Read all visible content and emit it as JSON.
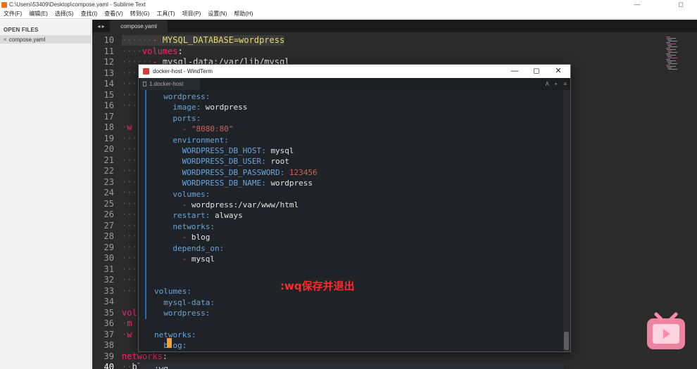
{
  "window": {
    "title": "C:\\Users\\53409\\Desktop\\compose.yaml - Sublime Text",
    "minimize": "—",
    "maximize": "◻",
    "close": "✕"
  },
  "menu": [
    "文件(F)",
    "编辑(E)",
    "选择(S)",
    "查找(I)",
    "查看(V)",
    "转到(G)",
    "工具(T)",
    "项目(P)",
    "设置(N)",
    "帮助(H)"
  ],
  "sidebar": {
    "heading": "OPEN FILES",
    "files": [
      {
        "close": "×",
        "name": "compose.yaml"
      }
    ]
  },
  "tabs": {
    "nav": "◂ ▸",
    "active": "compose.yaml"
  },
  "editor": {
    "line_numbers": [
      "10",
      "11",
      "12",
      "13",
      "14",
      "15",
      "16",
      "17",
      "18",
      "19",
      "20",
      "21",
      "22",
      "23",
      "24",
      "25",
      "26",
      "27",
      "28",
      "29",
      "30",
      "31",
      "32",
      "33",
      "34",
      "35",
      "36",
      "37",
      "38",
      "39",
      "40"
    ],
    "current_line": "40",
    "lines": [
      {
        "dots": "······",
        "key": "- ",
        "text": "MYSQL_DATABASE=wordpress",
        "hl": true
      },
      {
        "dots": "····",
        "key": "volumes",
        "text": ":"
      },
      {
        "dots": "······",
        "key": "- ",
        "text": "mysql-data:/var/lib/mysql"
      },
      {
        "dots": "····",
        "key": "",
        "text": ""
      },
      {
        "dots": "····",
        "key": "",
        "text": ""
      },
      {
        "dots": "···",
        "key": "",
        "text": ""
      },
      {
        "dots": "···",
        "key": "",
        "text": ""
      },
      {
        "dots": "",
        "key": "",
        "text": ""
      },
      {
        "dots": "·",
        "key": "w",
        "text": ""
      },
      {
        "dots": "···",
        "key": "",
        "text": ""
      },
      {
        "dots": "···",
        "key": "",
        "text": ""
      },
      {
        "dots": "···",
        "key": "",
        "text": ""
      },
      {
        "dots": "···",
        "key": "",
        "text": ""
      },
      {
        "dots": "···",
        "key": "",
        "text": ""
      },
      {
        "dots": "···",
        "key": "",
        "text": ""
      },
      {
        "dots": "···",
        "key": "",
        "text": ""
      },
      {
        "dots": "···",
        "key": "",
        "text": ""
      },
      {
        "dots": "···",
        "key": "",
        "text": ""
      },
      {
        "dots": "···",
        "key": "",
        "text": ""
      },
      {
        "dots": "···",
        "key": "",
        "text": ""
      },
      {
        "dots": "···",
        "key": "",
        "text": ""
      },
      {
        "dots": "···",
        "key": "",
        "text": ""
      },
      {
        "dots": "···",
        "key": "",
        "text": ""
      },
      {
        "dots": "···",
        "key": "",
        "text": ""
      },
      {
        "dots": "",
        "key": "",
        "text": ""
      },
      {
        "dots": "",
        "key": "vol",
        "text": ""
      },
      {
        "dots": "·",
        "key": "m",
        "text": ""
      },
      {
        "dots": "·",
        "key": "w",
        "text": ""
      },
      {
        "dots": "",
        "key": "",
        "text": ""
      },
      {
        "dots": "",
        "key": "networks",
        "text": ":"
      },
      {
        "dots": "··",
        "key": "",
        "text": "blog:"
      }
    ]
  },
  "terminal": {
    "title": "docker-host - WindTerm",
    "min": "—",
    "max": "◻",
    "close": "✕",
    "tab_label": "1.docker-host",
    "tab_icons": [
      "A",
      "+",
      "≡"
    ],
    "lines": [
      {
        "indent": 2,
        "key": "wordpress",
        "sep": ":",
        "val": ""
      },
      {
        "indent": 4,
        "key": "image",
        "sep": ": ",
        "val": "wordpress"
      },
      {
        "indent": 4,
        "key": "ports",
        "sep": ":",
        "val": ""
      },
      {
        "indent": 6,
        "key": "- ",
        "sep": "",
        "val": "\"8080:80\"",
        "red": true
      },
      {
        "indent": 4,
        "key": "environment",
        "sep": ":",
        "val": ""
      },
      {
        "indent": 6,
        "key": "WORDPRESS_DB_HOST",
        "sep": ": ",
        "val": "mysql"
      },
      {
        "indent": 6,
        "key": "WORDPRESS_DB_USER",
        "sep": ": ",
        "val": "root"
      },
      {
        "indent": 6,
        "key": "WORDPRESS_DB_PASSWORD",
        "sep": ": ",
        "val": "123456",
        "red": true
      },
      {
        "indent": 6,
        "key": "WORDPRESS_DB_NAME",
        "sep": ": ",
        "val": "wordpress"
      },
      {
        "indent": 4,
        "key": "volumes",
        "sep": ":",
        "val": ""
      },
      {
        "indent": 6,
        "key": "- ",
        "sep": "",
        "val": "wordpress:/var/www/html"
      },
      {
        "indent": 4,
        "key": "restart",
        "sep": ": ",
        "val": "always"
      },
      {
        "indent": 4,
        "key": "networks",
        "sep": ":",
        "val": ""
      },
      {
        "indent": 6,
        "key": "- ",
        "sep": "",
        "val": "blog"
      },
      {
        "indent": 4,
        "key": "depends_on",
        "sep": ":",
        "val": ""
      },
      {
        "indent": 6,
        "key": "- ",
        "sep": "",
        "val": "mysql"
      },
      {
        "indent": 0,
        "key": "",
        "sep": "",
        "val": ""
      },
      {
        "indent": 0,
        "key": "",
        "sep": "",
        "val": ""
      },
      {
        "indent": 0,
        "key": "volumes",
        "sep": ":",
        "val": ""
      },
      {
        "indent": 2,
        "key": "mysql-data",
        "sep": ":",
        "val": ""
      },
      {
        "indent": 2,
        "key": "wordpress",
        "sep": ":",
        "val": ""
      },
      {
        "indent": 0,
        "key": "",
        "sep": "",
        "val": ""
      },
      {
        "indent": 0,
        "key": "networks",
        "sep": ":",
        "val": ""
      },
      {
        "indent": 2,
        "key": "blog",
        "sep": ":",
        "val": ""
      }
    ],
    "command": ":wq"
  },
  "caption": ":wq保存并退出",
  "colors": {
    "accent_blue": "#1e6fb8",
    "caption_red": "#ff2a2a",
    "cursor": "#f0a030",
    "logo": "#fc8bab"
  },
  "icons": [
    "sublime-app-icon",
    "windterm-app-icon",
    "bilibili-tv-icon"
  ]
}
